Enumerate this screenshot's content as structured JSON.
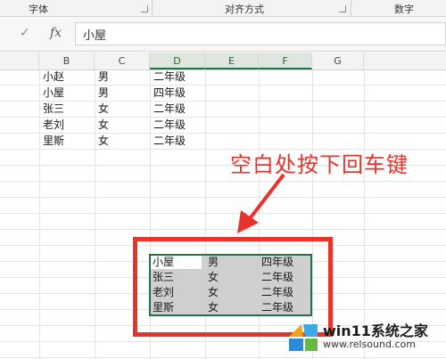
{
  "ribbon": {
    "groups": [
      "字体",
      "对齐方式",
      "数字"
    ]
  },
  "formula_bar": {
    "cancel_icon": "✓",
    "fx_label": "fx",
    "value": "小屋"
  },
  "columns": [
    "B",
    "C",
    "D",
    "E",
    "F",
    "G"
  ],
  "top_table": [
    [
      "小赵",
      "男",
      "二年级"
    ],
    [
      "小屋",
      "男",
      "四年级"
    ],
    [
      "张三",
      "女",
      "二年级"
    ],
    [
      "老刘",
      "女",
      "二年级"
    ],
    [
      "里斯",
      "女",
      "二年级"
    ]
  ],
  "selected_table": [
    [
      "小屋",
      "男",
      "四年级"
    ],
    [
      "张三",
      "女",
      "二年级"
    ],
    [
      "老刘",
      "女",
      "二年级"
    ],
    [
      "里斯",
      "女",
      "二年级"
    ]
  ],
  "annotation": {
    "text": "空白处按下回车键",
    "color": "#e8332b"
  },
  "watermark": {
    "title": "win11系统之家",
    "url": "www.relsound.com"
  },
  "colors": {
    "accent": "#217346",
    "annotation_red": "#e8332b"
  }
}
